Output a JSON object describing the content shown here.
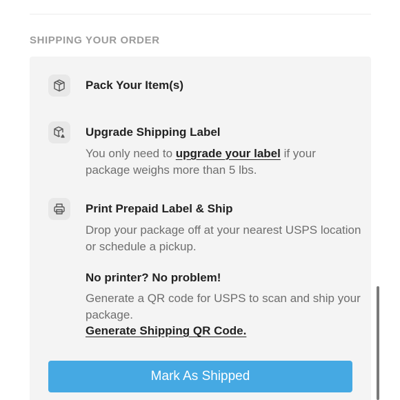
{
  "section": {
    "title": "SHIPPING YOUR ORDER"
  },
  "steps": [
    {
      "icon": "box-icon",
      "title": "Pack Your Item(s)"
    },
    {
      "icon": "box-upgrade-icon",
      "title": "Upgrade Shipping Label",
      "body_before": "You only need to ",
      "link": "upgrade your label",
      "body_after": " if your package weighs more than 5 lbs."
    },
    {
      "icon": "printer-icon",
      "title": "Print Prepaid Label & Ship",
      "body": "Drop your package off at your nearest USPS location or schedule a pickup."
    }
  ],
  "no_printer": {
    "title": "No printer? No problem!",
    "body": "Generate a QR code for USPS to scan and ship your package.",
    "link": "Generate Shipping QR Code."
  },
  "actions": {
    "mark_shipped": "Mark As Shipped"
  },
  "colors": {
    "accent": "#45a9e3",
    "panel": "#f4f4f4",
    "heading": "#9b9b9b"
  }
}
